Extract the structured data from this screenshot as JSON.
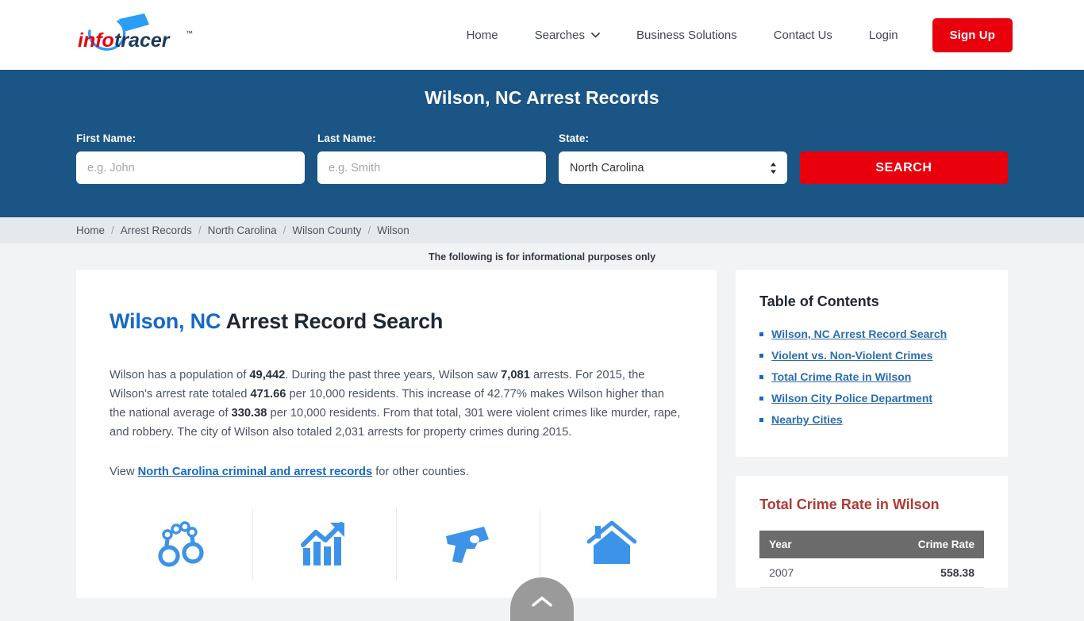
{
  "header": {
    "logo_info": "info",
    "logo_tracer": "tracer",
    "logo_tm": "™",
    "nav": [
      {
        "label": "Home",
        "has_caret": false,
        "icon": ""
      },
      {
        "label": "Searches",
        "has_caret": true,
        "icon": "chevron-down-icon"
      },
      {
        "label": "Business Solutions",
        "has_caret": false,
        "icon": ""
      },
      {
        "label": "Contact Us",
        "has_caret": false,
        "icon": ""
      },
      {
        "label": "Login",
        "has_caret": false,
        "icon": ""
      }
    ],
    "signup_label": "Sign Up"
  },
  "banner": {
    "title": "Wilson, NC Arrest Records",
    "first_name_label": "First Name:",
    "first_name_placeholder": "e.g. John",
    "first_name_value": "",
    "last_name_label": "Last Name:",
    "last_name_placeholder": "e.g. Smith",
    "last_name_value": "",
    "state_label": "State:",
    "state_selected": "North Carolina",
    "search_label": "SEARCH",
    "background_color": "#1a5586",
    "button_color": "#e8000d"
  },
  "breadcrumb": {
    "separator": "/",
    "items": [
      "Home",
      "Arrest Records",
      "North Carolina",
      "Wilson County",
      "Wilson"
    ]
  },
  "notice": "The following is for informational purposes only",
  "main": {
    "title_highlight": "Wilson, NC",
    "title_rest": " Arrest Record Search",
    "paragraph": {
      "p1": "Wilson has a population of ",
      "b1": "49,442",
      "p2": ". During the past three years, Wilson saw ",
      "b2": "7,081",
      "p3": " arrests. For 2015, the Wilson's arrest rate totaled ",
      "b3": "471.66",
      "p4": " per 10,000 residents. This increase of 42.77% makes Wilson higher than the national average of ",
      "b4": "330.38",
      "p5": " per 10,000 residents. From that total, 301 were violent crimes like murder, rape, and robbery. The city of Wilson also totaled 2,031 arrests for property crimes during 2015."
    },
    "view_prefix": "View ",
    "view_link": "North Carolina criminal and arrest records",
    "view_suffix": " for other counties.",
    "icons": [
      {
        "name": "handcuffs-icon"
      },
      {
        "name": "growth-chart-icon"
      },
      {
        "name": "gun-icon"
      },
      {
        "name": "house-icon"
      }
    ],
    "icon_color": "#3d93e8"
  },
  "sidebar": {
    "toc_title": "Table of Contents",
    "toc_items": [
      "Wilson, NC Arrest Record Search",
      "Violent vs. Non-Violent Crimes",
      "Total Crime Rate in Wilson",
      "Wilson City Police Department",
      "Nearby Cities"
    ],
    "crime_title": "Total Crime Rate in Wilson",
    "crime_headers": [
      "Year",
      "Crime Rate"
    ],
    "crime_rows": [
      {
        "year": "2007",
        "rate": "558.38"
      }
    ],
    "accent_color": "#b03a34",
    "link_color": "#2b6cb0"
  },
  "scroll_top": {
    "name": "scroll-to-top",
    "icon": "chevron-up-icon"
  }
}
